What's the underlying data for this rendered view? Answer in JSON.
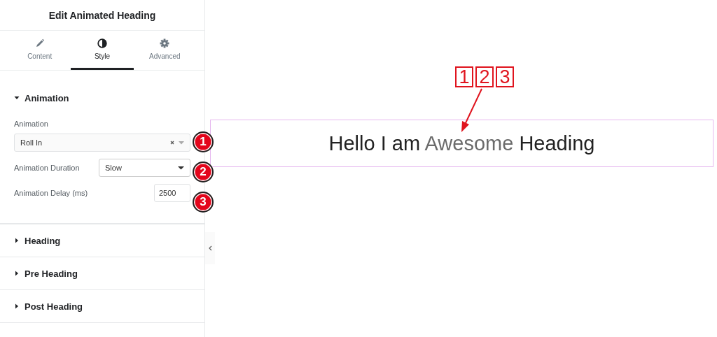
{
  "panel": {
    "title": "Edit Animated Heading",
    "tabs": [
      {
        "label": "Content",
        "selected": false
      },
      {
        "label": "Style",
        "selected": true
      },
      {
        "label": "Advanced",
        "selected": false
      }
    ],
    "sections": [
      {
        "title": "Animation",
        "expanded": true,
        "controls": [
          {
            "kind": "select-clearable",
            "label": "Animation",
            "value": "Roll In",
            "badge": "1"
          },
          {
            "kind": "select",
            "label": "Animation Duration",
            "value": "Slow",
            "badge": "2"
          },
          {
            "kind": "number",
            "label": "Animation Delay (ms)",
            "value": "2500",
            "badge": "3"
          }
        ]
      },
      {
        "title": "Heading",
        "expanded": false
      },
      {
        "title": "Pre Heading",
        "expanded": false
      },
      {
        "title": "Post Heading",
        "expanded": false
      }
    ]
  },
  "canvas": {
    "heading": {
      "before": "Hello I am",
      "animated": "Awesome",
      "after": "Heading"
    },
    "callout_labels": [
      "1",
      "2",
      "3"
    ]
  }
}
